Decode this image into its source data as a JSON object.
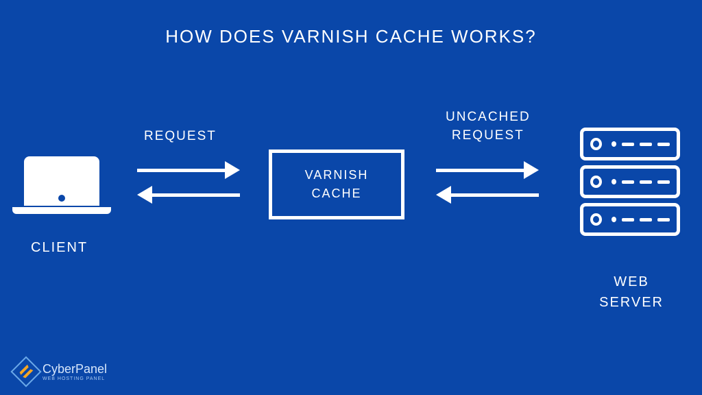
{
  "title": "HOW DOES VARNISH CACHE WORKS?",
  "nodes": {
    "client": {
      "label": "CLIENT"
    },
    "cache": {
      "label": "VARNISH\nCACHE"
    },
    "server": {
      "label": "WEB\nSERVER"
    }
  },
  "arrows": {
    "left_label": "REQUEST",
    "right_label": "UNCACHED\nREQUEST"
  },
  "brand": {
    "name": "CyberPanel",
    "tagline": "WEB HOSTING PANEL"
  }
}
